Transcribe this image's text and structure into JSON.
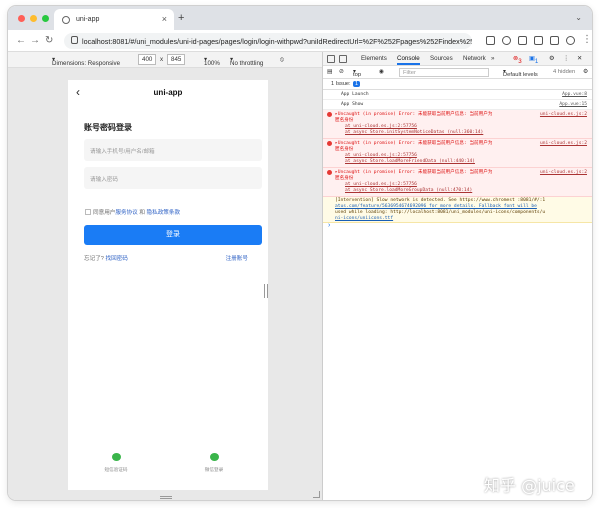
{
  "browser": {
    "tab_title": "uni-app",
    "url": "localhost:8081/#/uni_modules/uni-id-pages/pages/login/login-withpwd?uniIdRedirectUrl=%2F%252Fpages%252Findex%252Findex"
  },
  "device_toolbar": {
    "dimensions_label": "Dimensions: Responsive",
    "width": "400",
    "times": "x",
    "height": "845",
    "zoom": "100%",
    "throttle": "No throttling"
  },
  "phone": {
    "nav_title": "uni-app",
    "heading": "账号密码登录",
    "account_placeholder": "请输入手机号/用户名/邮箱",
    "password_placeholder": "请输入密码",
    "agree_prefix": "同意用户",
    "agree_service": "服务协议",
    "agree_and": "和",
    "agree_privacy": "隐私政策条款",
    "login_button": "登录",
    "forgot_prefix": "忘记了?",
    "forgot_link": "找回密码",
    "register_link": "注册账号",
    "alt_sms": "短信验证码",
    "alt_wechat": "微信登录"
  },
  "devtools": {
    "tabs": [
      "Elements",
      "Console",
      "Sources",
      "Network"
    ],
    "error_count": "3",
    "message_count": "1",
    "context": "top",
    "filter_placeholder": "Filter",
    "levels": "Default levels",
    "hidden": "4 hidden",
    "issues_label": "1 Issue:",
    "issues_count": "1",
    "logs": [
      {
        "text": "App Launch",
        "source": "App.vue:8"
      },
      {
        "text": "App Show",
        "source": "App.vue:15"
      }
    ],
    "errors": [
      {
        "line1": "▸Uncaught (in promise) Error: 未能获取当前用户信息: 当前用户为",
        "line2": "匿名身份",
        "source": "uni-cloud.es.js:2",
        "trace1": "at uni-cloud.es.js:2:57756",
        "trace2": "at async Store.initSystemNoticeDatas (null:360:14)"
      },
      {
        "line1": "▸Uncaught (in promise) Error: 未能获取当前用户信息: 当前用户为",
        "line2": "匿名身份",
        "source": "uni-cloud.es.js:2",
        "trace1": "at uni-cloud.es.js:2:57756",
        "trace2": "at async Store.loadMoreFriendData (null:440:14)"
      },
      {
        "line1": "▸Uncaught (in promise) Error: 未能获取当前用户信息: 当前用户为",
        "line2": "匿名身份",
        "source": "uni-cloud.es.js:2",
        "trace1": "at uni-cloud.es.js:2:57756",
        "trace2": "at async Store.loadMoreGroupData (null:470:14)"
      }
    ],
    "warning": {
      "line1": "[Intervention] Slow network is detected. See https://www.chromest :8081/#/:1",
      "line2": "atus.com/feature/5636954674692096 for more details. Fallback font will be",
      "line3": "used while loading: http://localhost:8081/uni_modules/uni-icons/components/u",
      "line4": "ni-icons/uniicons.ttf"
    },
    "prompt": "›"
  },
  "watermark": "知乎 @juice",
  "colors": {
    "primary": "#1a7cf5",
    "error": "#d11111",
    "link": "#2b5fc4"
  }
}
